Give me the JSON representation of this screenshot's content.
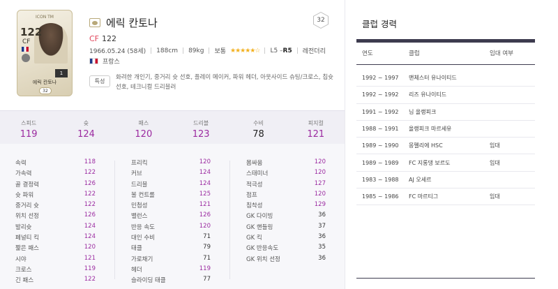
{
  "card": {
    "ovr": "122",
    "pos": "CF",
    "title": "ICON TM",
    "name": "에릭 칸토나",
    "number": "1",
    "grade": "32"
  },
  "player": {
    "name": "에릭 칸토나",
    "position": "CF",
    "ovr": "122",
    "birth": "1966.05.24 (58세)",
    "height": "188cm",
    "weight": "89kg",
    "body": "보통",
    "stars": "★★★★★☆",
    "skill_weak": "L5 – ",
    "skill_right": "R5",
    "type": "레전더리",
    "nation": "프랑스",
    "grade_badge": "32",
    "traits_label": "특성",
    "traits": "화려한 개인기, 중거리 슛 선호, 플레이 메이커, 파워 헤더, 아웃사이드 슈팅/크로스, 칩슛 선호, 테크니컬 드리블러"
  },
  "averages": [
    {
      "label": "스피드",
      "value": "119",
      "dark": false
    },
    {
      "label": "슛",
      "value": "124",
      "dark": false
    },
    {
      "label": "패스",
      "value": "120",
      "dark": false
    },
    {
      "label": "드리블",
      "value": "123",
      "dark": false
    },
    {
      "label": "수비",
      "value": "78",
      "dark": true
    },
    {
      "label": "피지컬",
      "value": "121",
      "dark": false
    }
  ],
  "stats": {
    "col1": [
      {
        "n": "속력",
        "v": "118"
      },
      {
        "n": "가속력",
        "v": "122"
      },
      {
        "n": "골 결정력",
        "v": "126"
      },
      {
        "n": "슛 파워",
        "v": "122"
      },
      {
        "n": "중거리 슛",
        "v": "122"
      },
      {
        "n": "위치 선정",
        "v": "126"
      },
      {
        "n": "발리슛",
        "v": "124"
      },
      {
        "n": "페널티 킥",
        "v": "124"
      },
      {
        "n": "짧은 패스",
        "v": "120"
      },
      {
        "n": "시야",
        "v": "121"
      },
      {
        "n": "크로스",
        "v": "119"
      },
      {
        "n": "긴 패스",
        "v": "122"
      }
    ],
    "col2": [
      {
        "n": "프리킥",
        "v": "120"
      },
      {
        "n": "커브",
        "v": "124"
      },
      {
        "n": "드리블",
        "v": "124"
      },
      {
        "n": "볼 컨트롤",
        "v": "125"
      },
      {
        "n": "민첩성",
        "v": "121"
      },
      {
        "n": "밸런스",
        "v": "126"
      },
      {
        "n": "반응 속도",
        "v": "120"
      },
      {
        "n": "대인 수비",
        "v": "71"
      },
      {
        "n": "태클",
        "v": "79"
      },
      {
        "n": "가로채기",
        "v": "71"
      },
      {
        "n": "헤더",
        "v": "119"
      },
      {
        "n": "슬라이딩 태클",
        "v": "77"
      }
    ],
    "col3": [
      {
        "n": "몸싸움",
        "v": "120"
      },
      {
        "n": "스태미너",
        "v": "120"
      },
      {
        "n": "적극성",
        "v": "127"
      },
      {
        "n": "점프",
        "v": "120"
      },
      {
        "n": "침착성",
        "v": "129"
      },
      {
        "n": "GK 다이빙",
        "v": "36"
      },
      {
        "n": "GK 핸들링",
        "v": "37"
      },
      {
        "n": "GK 킥",
        "v": "36"
      },
      {
        "n": "GK 반응속도",
        "v": "35"
      },
      {
        "n": "GK 위치 선정",
        "v": "36"
      }
    ]
  },
  "career": {
    "title": "클럽 경력",
    "headers": [
      "연도",
      "클럽",
      "임대 여부"
    ],
    "rows": [
      {
        "year": "1992 ~ 1997",
        "club": "맨체스터 유나이티드",
        "loan": ""
      },
      {
        "year": "1992 ~ 1992",
        "club": "리즈 유나이티드",
        "loan": ""
      },
      {
        "year": "1991 ~ 1992",
        "club": "님 올랭피크",
        "loan": ""
      },
      {
        "year": "1988 ~ 1991",
        "club": "올랭피크 마르세유",
        "loan": ""
      },
      {
        "year": "1989 ~ 1990",
        "club": "몽펠리에 HSC",
        "loan": "임대"
      },
      {
        "year": "1989 ~ 1989",
        "club": "FC 지롱댕 보르도",
        "loan": "임대"
      },
      {
        "year": "1983 ~ 1988",
        "club": "AJ 오세르",
        "loan": ""
      },
      {
        "year": "1985 ~ 1986",
        "club": "FC 마르티그",
        "loan": "임대"
      }
    ]
  }
}
